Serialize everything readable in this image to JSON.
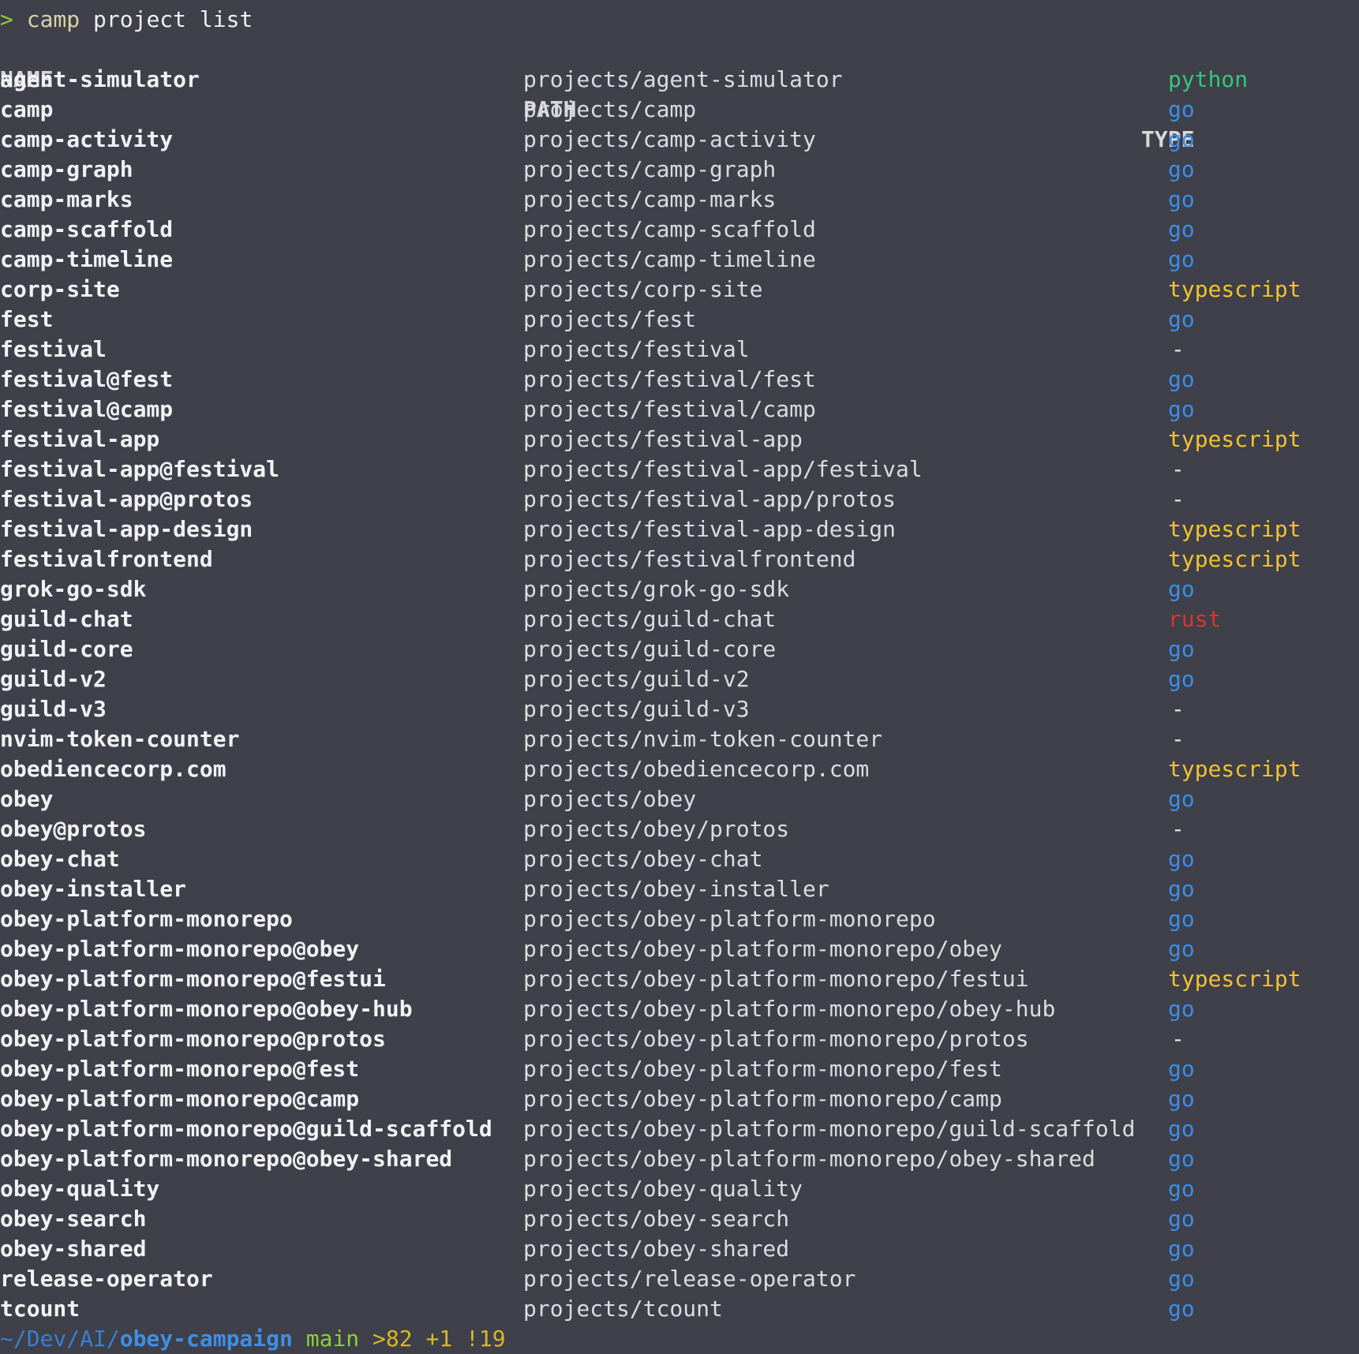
{
  "prompt": {
    "symbol": ">",
    "command": "camp",
    "args": " project list"
  },
  "headers": {
    "name": "NAME",
    "path": "PATH",
    "type": "TYPE"
  },
  "colors": {
    "python": "#34c77b",
    "go": "#3b8ee8",
    "typescript": "#f2c230",
    "rust": "#e0342c",
    "-": "#e6e6e8"
  },
  "rows": [
    {
      "name": "agent-simulator",
      "path": "projects/agent-simulator",
      "type": "python"
    },
    {
      "name": "camp",
      "path": "projects/camp",
      "type": "go"
    },
    {
      "name": "camp-activity",
      "path": "projects/camp-activity",
      "type": "go"
    },
    {
      "name": "camp-graph",
      "path": "projects/camp-graph",
      "type": "go"
    },
    {
      "name": "camp-marks",
      "path": "projects/camp-marks",
      "type": "go"
    },
    {
      "name": "camp-scaffold",
      "path": "projects/camp-scaffold",
      "type": "go"
    },
    {
      "name": "camp-timeline",
      "path": "projects/camp-timeline",
      "type": "go"
    },
    {
      "name": "corp-site",
      "path": "projects/corp-site",
      "type": "typescript"
    },
    {
      "name": "fest",
      "path": "projects/fest",
      "type": "go"
    },
    {
      "name": "festival",
      "path": "projects/festival",
      "type": "-"
    },
    {
      "name": "festival@fest",
      "path": "projects/festival/fest",
      "type": "go"
    },
    {
      "name": "festival@camp",
      "path": "projects/festival/camp",
      "type": "go"
    },
    {
      "name": "festival-app",
      "path": "projects/festival-app",
      "type": "typescript"
    },
    {
      "name": "festival-app@festival",
      "path": "projects/festival-app/festival",
      "type": "-"
    },
    {
      "name": "festival-app@protos",
      "path": "projects/festival-app/protos",
      "type": "-"
    },
    {
      "name": "festival-app-design",
      "path": "projects/festival-app-design",
      "type": "typescript"
    },
    {
      "name": "festivalfrontend",
      "path": "projects/festivalfrontend",
      "type": "typescript"
    },
    {
      "name": "grok-go-sdk",
      "path": "projects/grok-go-sdk",
      "type": "go"
    },
    {
      "name": "guild-chat",
      "path": "projects/guild-chat",
      "type": "rust"
    },
    {
      "name": "guild-core",
      "path": "projects/guild-core",
      "type": "go"
    },
    {
      "name": "guild-v2",
      "path": "projects/guild-v2",
      "type": "go"
    },
    {
      "name": "guild-v3",
      "path": "projects/guild-v3",
      "type": "-"
    },
    {
      "name": "nvim-token-counter",
      "path": "projects/nvim-token-counter",
      "type": "-"
    },
    {
      "name": "obediencecorp.com",
      "path": "projects/obediencecorp.com",
      "type": "typescript"
    },
    {
      "name": "obey",
      "path": "projects/obey",
      "type": "go"
    },
    {
      "name": "obey@protos",
      "path": "projects/obey/protos",
      "type": "-"
    },
    {
      "name": "obey-chat",
      "path": "projects/obey-chat",
      "type": "go"
    },
    {
      "name": "obey-installer",
      "path": "projects/obey-installer",
      "type": "go"
    },
    {
      "name": "obey-platform-monorepo",
      "path": "projects/obey-platform-monorepo",
      "type": "go"
    },
    {
      "name": "obey-platform-monorepo@obey",
      "path": "projects/obey-platform-monorepo/obey",
      "type": "go"
    },
    {
      "name": "obey-platform-monorepo@festui",
      "path": "projects/obey-platform-monorepo/festui",
      "type": "typescript"
    },
    {
      "name": "obey-platform-monorepo@obey-hub",
      "path": "projects/obey-platform-monorepo/obey-hub",
      "type": "go"
    },
    {
      "name": "obey-platform-monorepo@protos",
      "path": "projects/obey-platform-monorepo/protos",
      "type": "-"
    },
    {
      "name": "obey-platform-monorepo@fest",
      "path": "projects/obey-platform-monorepo/fest",
      "type": "go"
    },
    {
      "name": "obey-platform-monorepo@camp",
      "path": "projects/obey-platform-monorepo/camp",
      "type": "go"
    },
    {
      "name": "obey-platform-monorepo@guild-scaffold",
      "path": "projects/obey-platform-monorepo/guild-scaffold",
      "type": "go"
    },
    {
      "name": "obey-platform-monorepo@obey-shared",
      "path": "projects/obey-platform-monorepo/obey-shared",
      "type": "go"
    },
    {
      "name": "obey-quality",
      "path": "projects/obey-quality",
      "type": "go"
    },
    {
      "name": "obey-search",
      "path": "projects/obey-search",
      "type": "go"
    },
    {
      "name": "obey-shared",
      "path": "projects/obey-shared",
      "type": "go"
    },
    {
      "name": "release-operator",
      "path": "projects/release-operator",
      "type": "go"
    },
    {
      "name": "tcount",
      "path": "projects/tcount",
      "type": "go"
    }
  ],
  "bottom_prompt": {
    "dir_prefix": "~/Dev/AI/",
    "dir_name": "obey-campaign",
    "branch": " main",
    "status": " >82 +1 !19"
  }
}
